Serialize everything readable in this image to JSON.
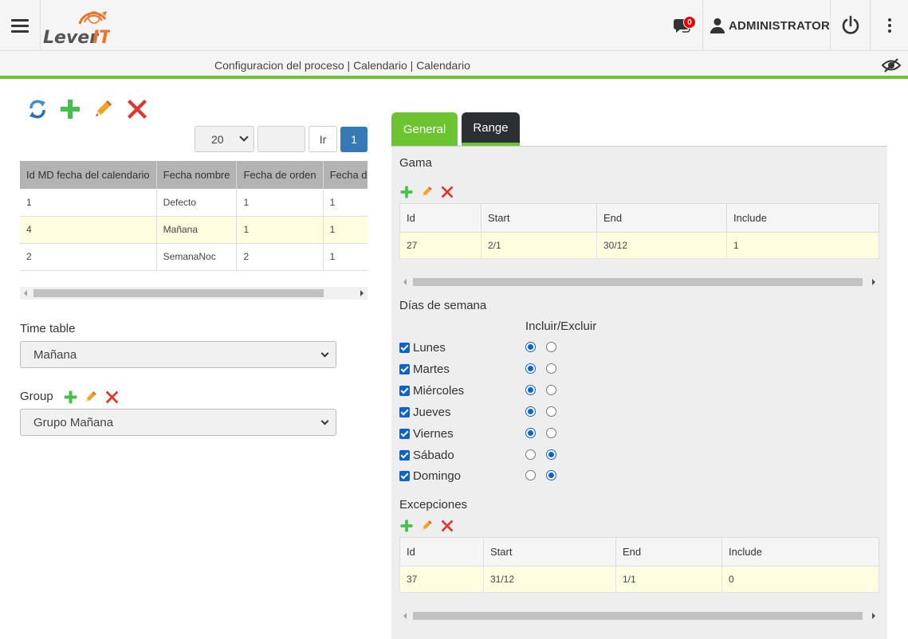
{
  "header": {
    "logo_text": "Lever IT",
    "notifications_count": "0",
    "user_name": "ADMINISTRATOR"
  },
  "breadcrumb": "Configuracion del proceso | Calendario | Calendario",
  "pager": {
    "page_size": "20",
    "page_input": "",
    "go_label": "Ir",
    "current_page": "1"
  },
  "calendar_table": {
    "columns": [
      "Id MD fecha del calendario",
      "Fecha nombre",
      "Fecha de orden",
      "Fecha de e"
    ],
    "rows": [
      [
        "1",
        "Defecto",
        "1",
        "1"
      ],
      [
        "4",
        "Mañana",
        "1",
        "1"
      ],
      [
        "2",
        "SemanaNoc",
        "2",
        "1"
      ]
    ]
  },
  "time_table": {
    "label": "Time table",
    "value": "Mañana"
  },
  "group": {
    "label": "Group",
    "value": "Grupo Mañana"
  },
  "tabs": [
    {
      "label": "General"
    },
    {
      "label": "Range"
    }
  ],
  "gama": {
    "title": "Gama",
    "columns": [
      "Id",
      "Start",
      "End",
      "Include"
    ],
    "rows": [
      [
        "27",
        "2/1",
        "30/12",
        "1"
      ]
    ]
  },
  "weekdays": {
    "title": "Días de semana",
    "toggle_header": "Incluir/Excluir",
    "days": [
      {
        "label": "Lunes",
        "checked": true,
        "include": true
      },
      {
        "label": "Martes",
        "checked": true,
        "include": true
      },
      {
        "label": "Miércoles",
        "checked": true,
        "include": true
      },
      {
        "label": "Jueves",
        "checked": true,
        "include": true
      },
      {
        "label": "Viernes",
        "checked": true,
        "include": true
      },
      {
        "label": "Sábado",
        "checked": true,
        "include": false
      },
      {
        "label": "Domingo",
        "checked": true,
        "include": false
      }
    ]
  },
  "excepciones": {
    "title": "Excepciones",
    "columns": [
      "Id",
      "Start",
      "End",
      "Include"
    ],
    "rows": [
      [
        "37",
        "31/12",
        "1/1",
        "0"
      ]
    ]
  },
  "colors": {
    "accent_green": "#6cc431",
    "dark_tab": "#2b3035",
    "primary_blue": "#337ab7",
    "row_highlight": "#fffde0"
  }
}
